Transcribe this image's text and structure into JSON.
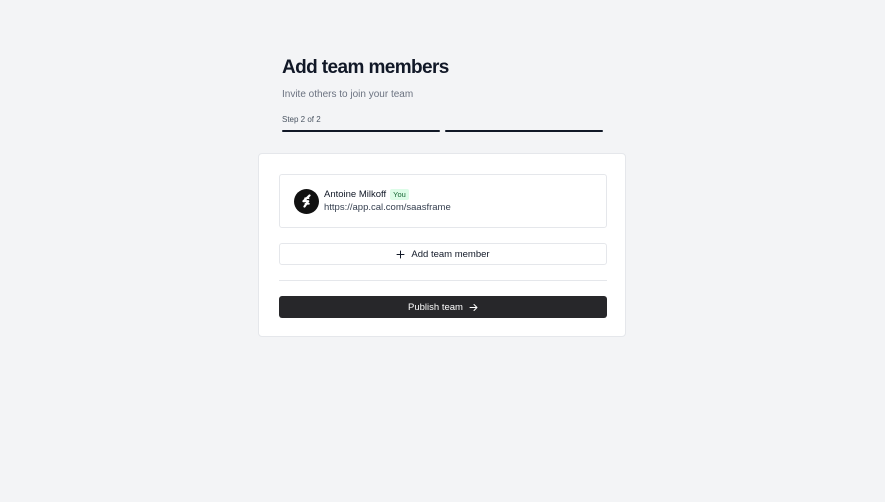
{
  "header": {
    "title": "Add team members",
    "subtitle": "Invite others to join your team",
    "step_label": "Step 2 of 2",
    "steps_total": 2,
    "current_step": 2
  },
  "member": {
    "name": "Antoine Milkoff",
    "badge": "You",
    "url": "https://app.cal.com/saasframe",
    "avatar_icon": "logo-icon"
  },
  "actions": {
    "add_member_label": "Add team member",
    "add_member_icon": "plus-icon",
    "publish_label": "Publish team",
    "publish_icon": "arrow-right-icon"
  },
  "colors": {
    "background": "#f3f4f6",
    "primary_button": "#27272a",
    "badge_bg": "#dcfce7",
    "badge_text": "#166534"
  }
}
